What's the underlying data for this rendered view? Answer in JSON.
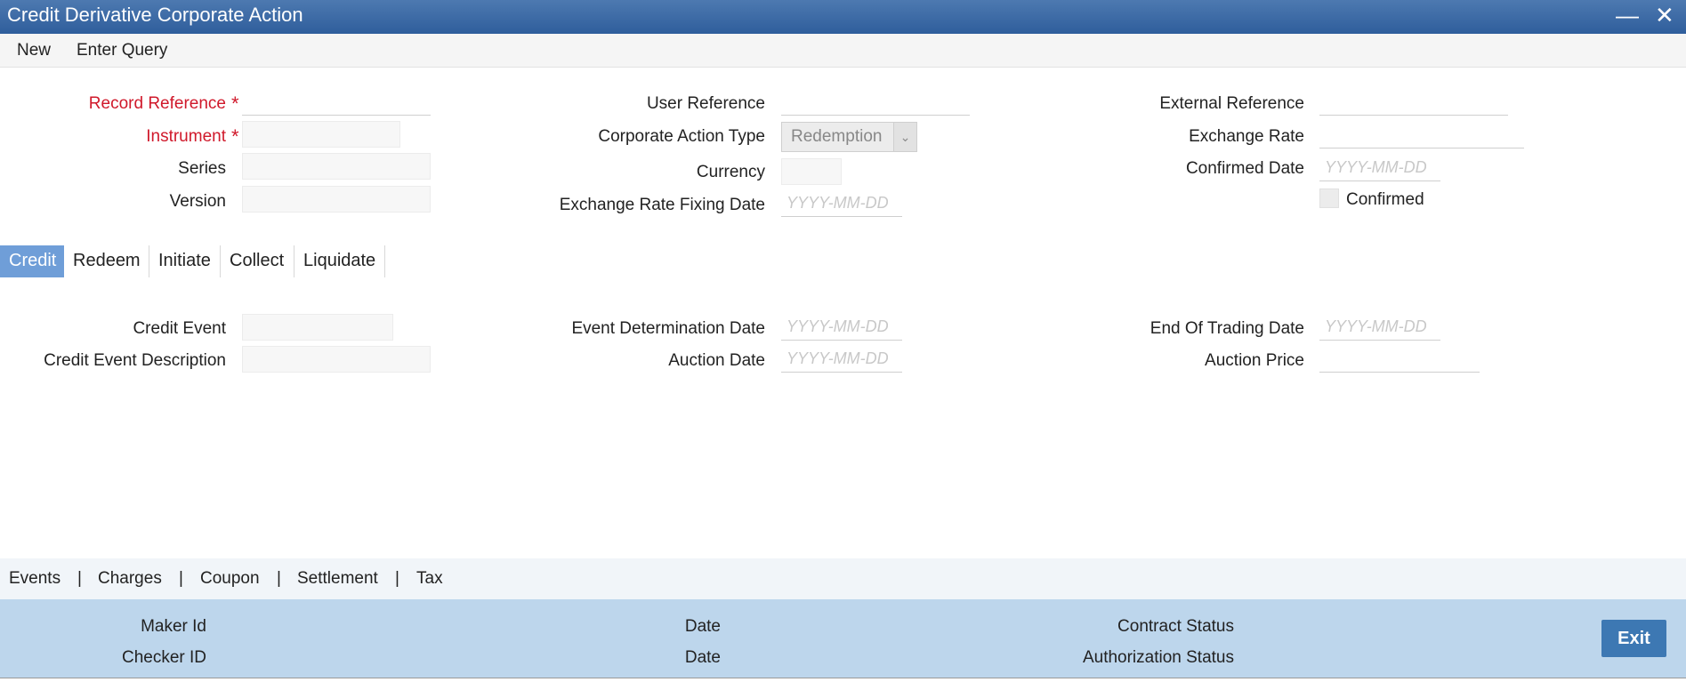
{
  "window": {
    "title": "Credit Derivative Corporate Action",
    "minimize_icon": "minus-icon",
    "close_icon": "close-icon",
    "minimize_glyph": "—",
    "close_glyph": "✕"
  },
  "menu": {
    "new_label": "New",
    "enter_query_label": "Enter Query"
  },
  "header_fields": {
    "record_reference": {
      "label": "Record Reference",
      "value": ""
    },
    "instrument": {
      "label": "Instrument",
      "value": ""
    },
    "series": {
      "label": "Series",
      "value": ""
    },
    "version": {
      "label": "Version",
      "value": ""
    },
    "user_reference": {
      "label": "User Reference",
      "value": ""
    },
    "corporate_action_type": {
      "label": "Corporate Action Type",
      "value": "Redemption"
    },
    "currency": {
      "label": "Currency",
      "value": ""
    },
    "exchange_rate_fixing_date": {
      "label": "Exchange Rate Fixing Date",
      "placeholder": "YYYY-MM-DD"
    },
    "external_reference": {
      "label": "External Reference",
      "value": ""
    },
    "exchange_rate": {
      "label": "Exchange Rate",
      "value": ""
    },
    "confirmed_date": {
      "label": "Confirmed Date",
      "placeholder": "YYYY-MM-DD"
    },
    "confirmed": {
      "label": "Confirmed",
      "checked": false
    }
  },
  "required_marker": "*",
  "tabs": [
    {
      "label": "Credit",
      "active": true
    },
    {
      "label": "Redeem",
      "active": false
    },
    {
      "label": "Initiate",
      "active": false
    },
    {
      "label": "Collect",
      "active": false
    },
    {
      "label": "Liquidate",
      "active": false
    }
  ],
  "credit_tab": {
    "credit_event": {
      "label": "Credit Event",
      "value": ""
    },
    "credit_event_description": {
      "label": "Credit Event Description",
      "value": ""
    },
    "event_determination_date": {
      "label": "Event Determination Date",
      "placeholder": "YYYY-MM-DD"
    },
    "auction_date": {
      "label": "Auction Date",
      "placeholder": "YYYY-MM-DD"
    },
    "end_of_trading_date": {
      "label": "End Of Trading Date",
      "placeholder": "YYYY-MM-DD"
    },
    "auction_price": {
      "label": "Auction Price",
      "value": ""
    }
  },
  "footer_links": [
    "Events",
    "Charges",
    "Coupon",
    "Settlement",
    "Tax"
  ],
  "footer_separator": "|",
  "status": {
    "maker_id_label": "Maker Id",
    "checker_id_label": "Checker ID",
    "date_label_1": "Date",
    "date_label_2": "Date",
    "contract_status_label": "Contract Status",
    "authorization_status_label": "Authorization Status",
    "exit_label": "Exit"
  },
  "colors": {
    "title_bar": "#3b6aa8",
    "active_tab": "#6f9ed8",
    "status_bar": "#bdd6ec",
    "exit_button": "#3d78b3",
    "required": "#d0192b"
  }
}
